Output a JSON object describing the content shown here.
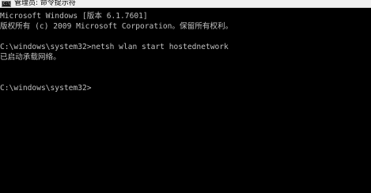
{
  "window": {
    "title": "管理员: 命令提示符",
    "icon": "cmd-icon",
    "icon_glyph": "C:\\"
  },
  "console": {
    "lines": [
      "Microsoft Windows [版本 6.1.7601]",
      "版权所有 (c) 2009 Microsoft Corporation。保留所有权利。",
      "",
      "C:\\windows\\system32>netsh wlan start hostednetwork",
      "已启动承载网络。",
      "",
      "",
      "C:\\windows\\system32>"
    ]
  },
  "colors": {
    "console_bg": "#000000",
    "console_text": "#c0c0c0",
    "titlebar_bg": "#f0f0f0"
  }
}
